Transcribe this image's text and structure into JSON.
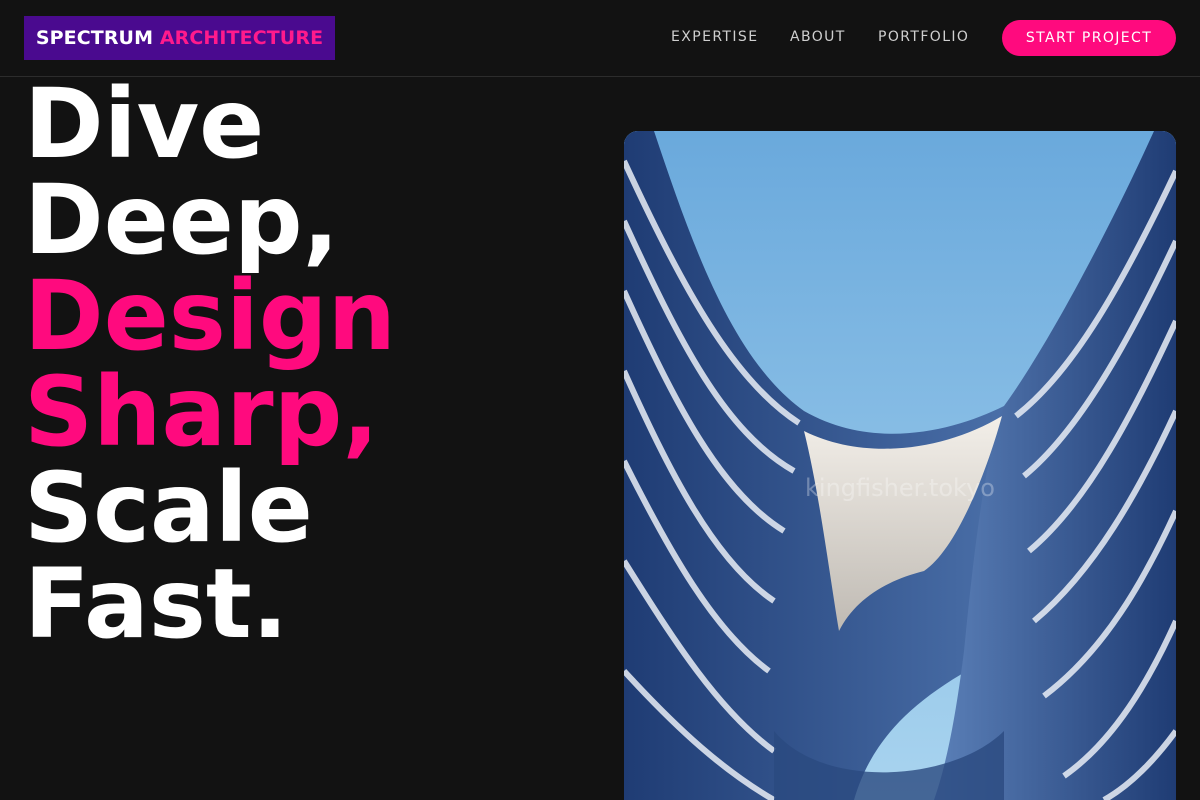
{
  "header": {
    "logo_primary": "SPECTRUM",
    "logo_accent": "ARCHITECTURE",
    "nav": [
      {
        "label": "EXPERTISE"
      },
      {
        "label": "ABOUT"
      },
      {
        "label": "PORTFOLIO"
      }
    ],
    "cta_label": "START PROJECT"
  },
  "hero": {
    "lines": [
      {
        "text": "Dive",
        "accent": false
      },
      {
        "text": "Deep,",
        "accent": false
      },
      {
        "text": "Design",
        "accent": true
      },
      {
        "text": "Sharp,",
        "accent": true
      },
      {
        "text": "Scale",
        "accent": false
      },
      {
        "text": "Fast.",
        "accent": true
      }
    ],
    "image_watermark": "kingfisher.tokyo"
  },
  "colors": {
    "background": "#121212",
    "accent": "#ff0a7e",
    "logo_bg": "#4a0a8f"
  }
}
